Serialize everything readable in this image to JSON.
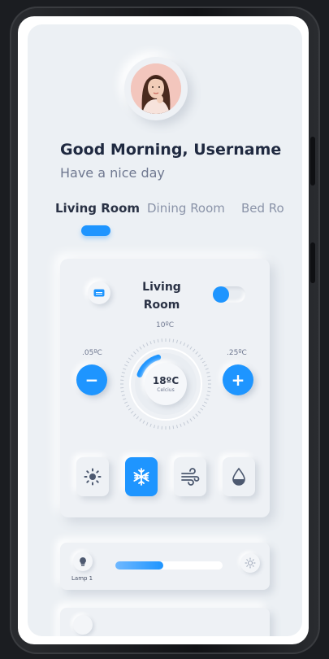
{
  "header": {
    "greeting": "Good Morning, Username",
    "subtitle": "Have a nice day"
  },
  "tabs": [
    {
      "label": "Living Room",
      "active": true
    },
    {
      "label": "Dining Room",
      "active": false
    },
    {
      "label": "Bed Ro",
      "active": false
    }
  ],
  "ac_card": {
    "title_line1": "Living",
    "title_line2": "Room",
    "power_on": true,
    "top_temp": "10ºC",
    "left_temp": ".05ºC",
    "right_temp": ".25ºC",
    "decrease_label": "−",
    "increase_label": "+",
    "current_temp": "18ºC",
    "unit_label": "Celcius",
    "dial_level": 0.25,
    "modes": [
      {
        "name": "sun",
        "active": false
      },
      {
        "name": "snowflake",
        "active": true
      },
      {
        "name": "wind",
        "active": false
      },
      {
        "name": "drop",
        "active": false
      }
    ]
  },
  "lamp": {
    "label": "Lamp 1",
    "brightness": 0.45
  },
  "colors": {
    "accent": "#1e95ff",
    "background": "#ecf0f4",
    "text_dark": "#1f2940",
    "text_muted": "#6f7890"
  }
}
